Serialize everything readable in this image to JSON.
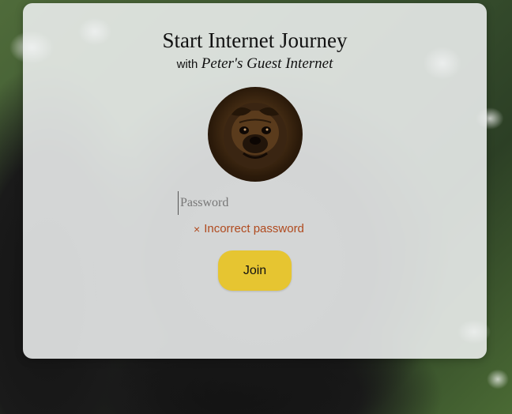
{
  "header": {
    "title": "Start Internet Journey",
    "subtitle_prefix": "with",
    "network_name": "Peter's Guest Internet"
  },
  "avatar": {
    "icon": "pug-dog-photo"
  },
  "form": {
    "password_placeholder": "Password",
    "password_value": "",
    "error_icon": "×",
    "error_message": "Incorrect password",
    "submit_label": "Join"
  },
  "colors": {
    "accent_button": "#e6c531",
    "error_text": "#b04a1e",
    "card_background": "#eef0f0"
  }
}
